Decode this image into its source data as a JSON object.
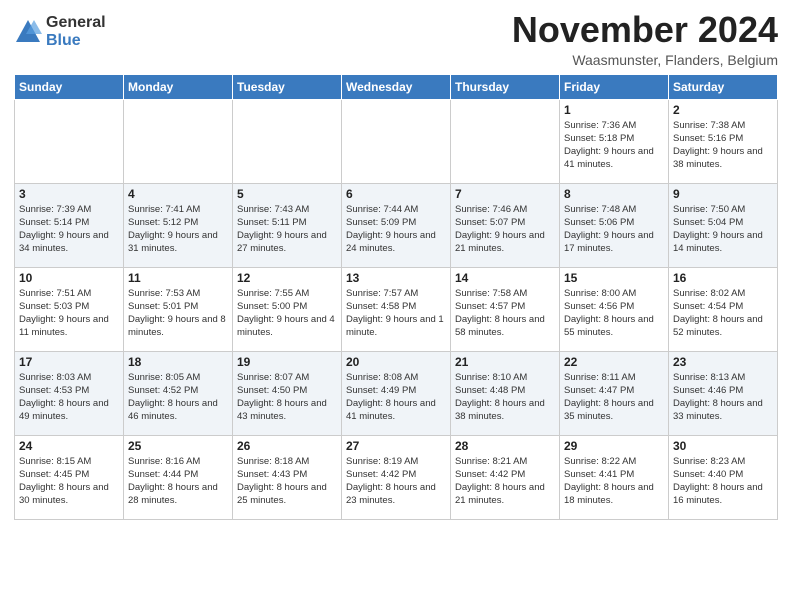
{
  "logo": {
    "general": "General",
    "blue": "Blue"
  },
  "header": {
    "month": "November 2024",
    "location": "Waasmunster, Flanders, Belgium"
  },
  "days_of_week": [
    "Sunday",
    "Monday",
    "Tuesday",
    "Wednesday",
    "Thursday",
    "Friday",
    "Saturday"
  ],
  "weeks": [
    [
      {
        "day": "",
        "info": ""
      },
      {
        "day": "",
        "info": ""
      },
      {
        "day": "",
        "info": ""
      },
      {
        "day": "",
        "info": ""
      },
      {
        "day": "",
        "info": ""
      },
      {
        "day": "1",
        "info": "Sunrise: 7:36 AM\nSunset: 5:18 PM\nDaylight: 9 hours and 41 minutes."
      },
      {
        "day": "2",
        "info": "Sunrise: 7:38 AM\nSunset: 5:16 PM\nDaylight: 9 hours and 38 minutes."
      }
    ],
    [
      {
        "day": "3",
        "info": "Sunrise: 7:39 AM\nSunset: 5:14 PM\nDaylight: 9 hours and 34 minutes."
      },
      {
        "day": "4",
        "info": "Sunrise: 7:41 AM\nSunset: 5:12 PM\nDaylight: 9 hours and 31 minutes."
      },
      {
        "day": "5",
        "info": "Sunrise: 7:43 AM\nSunset: 5:11 PM\nDaylight: 9 hours and 27 minutes."
      },
      {
        "day": "6",
        "info": "Sunrise: 7:44 AM\nSunset: 5:09 PM\nDaylight: 9 hours and 24 minutes."
      },
      {
        "day": "7",
        "info": "Sunrise: 7:46 AM\nSunset: 5:07 PM\nDaylight: 9 hours and 21 minutes."
      },
      {
        "day": "8",
        "info": "Sunrise: 7:48 AM\nSunset: 5:06 PM\nDaylight: 9 hours and 17 minutes."
      },
      {
        "day": "9",
        "info": "Sunrise: 7:50 AM\nSunset: 5:04 PM\nDaylight: 9 hours and 14 minutes."
      }
    ],
    [
      {
        "day": "10",
        "info": "Sunrise: 7:51 AM\nSunset: 5:03 PM\nDaylight: 9 hours and 11 minutes."
      },
      {
        "day": "11",
        "info": "Sunrise: 7:53 AM\nSunset: 5:01 PM\nDaylight: 9 hours and 8 minutes."
      },
      {
        "day": "12",
        "info": "Sunrise: 7:55 AM\nSunset: 5:00 PM\nDaylight: 9 hours and 4 minutes."
      },
      {
        "day": "13",
        "info": "Sunrise: 7:57 AM\nSunset: 4:58 PM\nDaylight: 9 hours and 1 minute."
      },
      {
        "day": "14",
        "info": "Sunrise: 7:58 AM\nSunset: 4:57 PM\nDaylight: 8 hours and 58 minutes."
      },
      {
        "day": "15",
        "info": "Sunrise: 8:00 AM\nSunset: 4:56 PM\nDaylight: 8 hours and 55 minutes."
      },
      {
        "day": "16",
        "info": "Sunrise: 8:02 AM\nSunset: 4:54 PM\nDaylight: 8 hours and 52 minutes."
      }
    ],
    [
      {
        "day": "17",
        "info": "Sunrise: 8:03 AM\nSunset: 4:53 PM\nDaylight: 8 hours and 49 minutes."
      },
      {
        "day": "18",
        "info": "Sunrise: 8:05 AM\nSunset: 4:52 PM\nDaylight: 8 hours and 46 minutes."
      },
      {
        "day": "19",
        "info": "Sunrise: 8:07 AM\nSunset: 4:50 PM\nDaylight: 8 hours and 43 minutes."
      },
      {
        "day": "20",
        "info": "Sunrise: 8:08 AM\nSunset: 4:49 PM\nDaylight: 8 hours and 41 minutes."
      },
      {
        "day": "21",
        "info": "Sunrise: 8:10 AM\nSunset: 4:48 PM\nDaylight: 8 hours and 38 minutes."
      },
      {
        "day": "22",
        "info": "Sunrise: 8:11 AM\nSunset: 4:47 PM\nDaylight: 8 hours and 35 minutes."
      },
      {
        "day": "23",
        "info": "Sunrise: 8:13 AM\nSunset: 4:46 PM\nDaylight: 8 hours and 33 minutes."
      }
    ],
    [
      {
        "day": "24",
        "info": "Sunrise: 8:15 AM\nSunset: 4:45 PM\nDaylight: 8 hours and 30 minutes."
      },
      {
        "day": "25",
        "info": "Sunrise: 8:16 AM\nSunset: 4:44 PM\nDaylight: 8 hours and 28 minutes."
      },
      {
        "day": "26",
        "info": "Sunrise: 8:18 AM\nSunset: 4:43 PM\nDaylight: 8 hours and 25 minutes."
      },
      {
        "day": "27",
        "info": "Sunrise: 8:19 AM\nSunset: 4:42 PM\nDaylight: 8 hours and 23 minutes."
      },
      {
        "day": "28",
        "info": "Sunrise: 8:21 AM\nSunset: 4:42 PM\nDaylight: 8 hours and 21 minutes."
      },
      {
        "day": "29",
        "info": "Sunrise: 8:22 AM\nSunset: 4:41 PM\nDaylight: 8 hours and 18 minutes."
      },
      {
        "day": "30",
        "info": "Sunrise: 8:23 AM\nSunset: 4:40 PM\nDaylight: 8 hours and 16 minutes."
      }
    ]
  ]
}
